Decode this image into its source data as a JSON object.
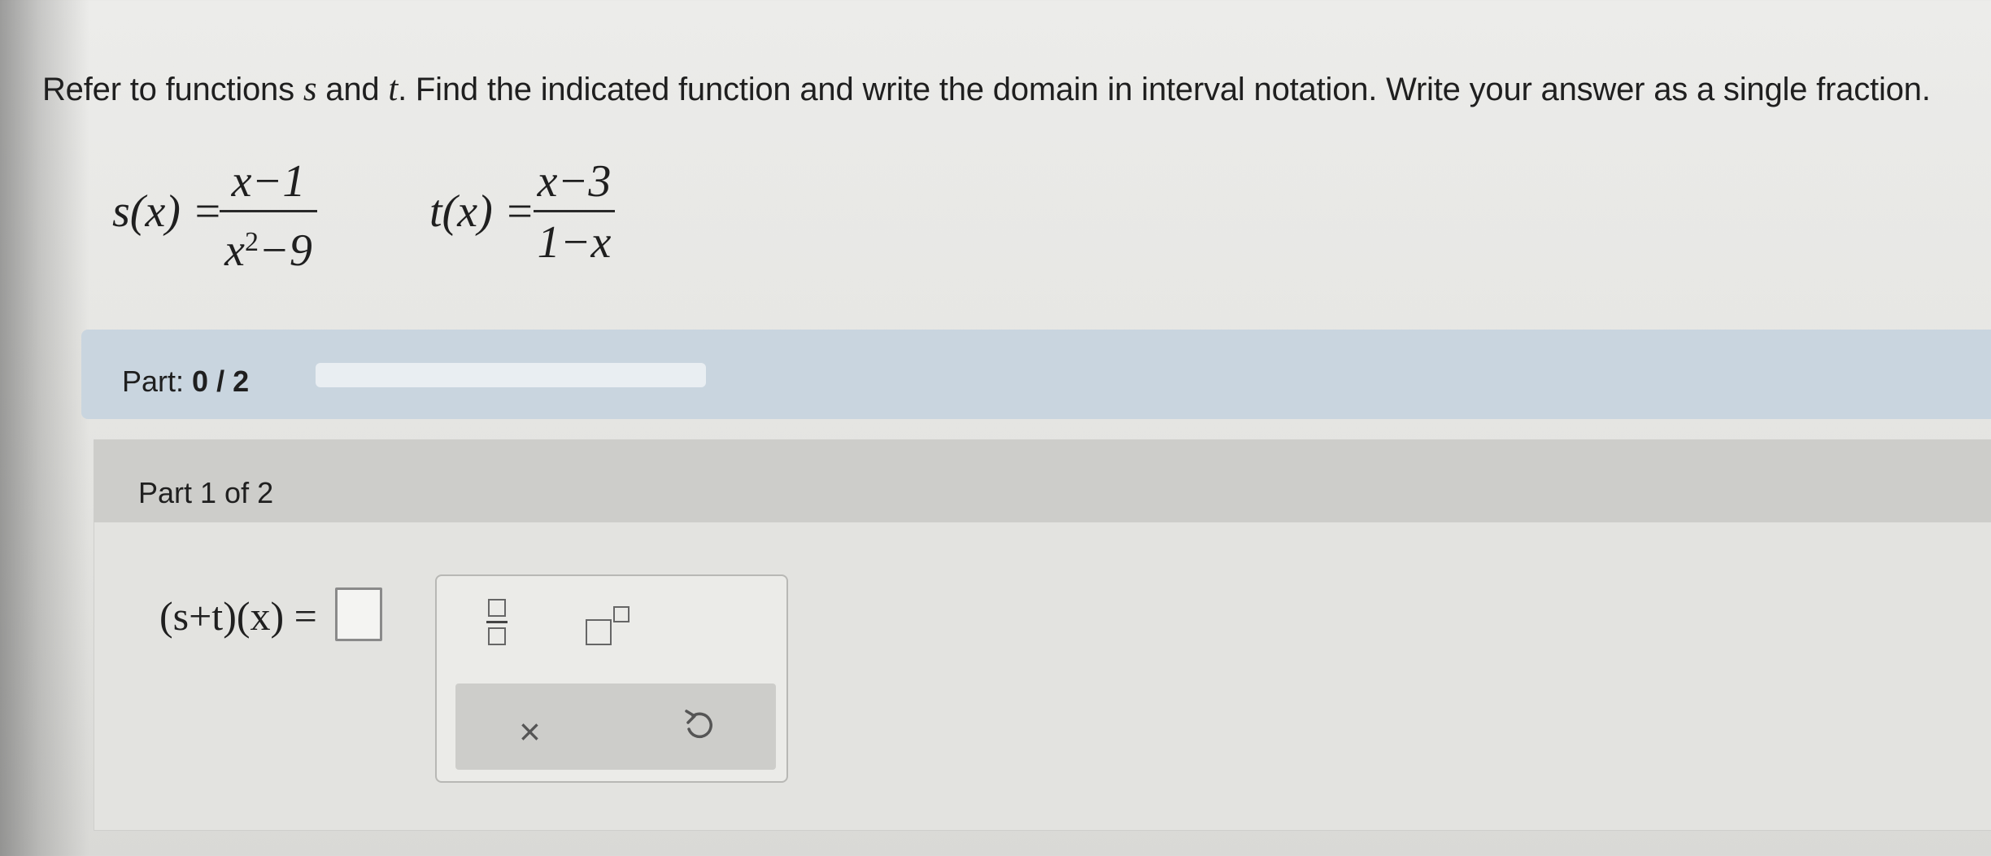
{
  "instructions": {
    "part1": "Refer to functions ",
    "var_s": "s",
    "part2": " and ",
    "var_t": "t",
    "part3": ". Find the indicated function and write the domain in interval notation. Write your answer as a single fraction."
  },
  "functions": {
    "s": {
      "lhs": "s(x) =",
      "numerator": "x−1",
      "den_base": "x",
      "den_exp": "2",
      "den_rest": "−9"
    },
    "t": {
      "lhs": "t(x) =",
      "numerator": "x−3",
      "denominator": "1−x"
    }
  },
  "progress": {
    "label": "Part: ",
    "current": "0",
    "sep": " / ",
    "total": "2",
    "fraction_complete": 0
  },
  "part": {
    "title": "Part 1 of 2"
  },
  "answer": {
    "expression": "(s+t)(x) =",
    "value": ""
  },
  "toolbox": {
    "tools": [
      {
        "name": "fraction-icon"
      },
      {
        "name": "superscript-icon"
      },
      {
        "name": "clear-icon",
        "glyph": "×"
      },
      {
        "name": "undo-icon"
      }
    ]
  },
  "colors": {
    "part_bar": "#c9d5df",
    "header": "#cdcdca"
  }
}
